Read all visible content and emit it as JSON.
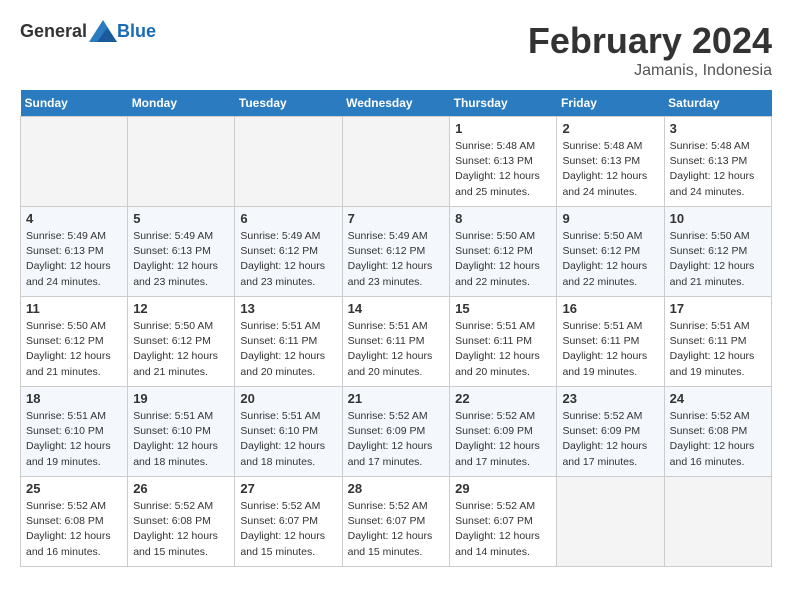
{
  "header": {
    "logo_general": "General",
    "logo_blue": "Blue",
    "month_title": "February 2024",
    "subtitle": "Jamanis, Indonesia"
  },
  "days_of_week": [
    "Sunday",
    "Monday",
    "Tuesday",
    "Wednesday",
    "Thursday",
    "Friday",
    "Saturday"
  ],
  "weeks": [
    [
      {
        "day": "",
        "info": ""
      },
      {
        "day": "",
        "info": ""
      },
      {
        "day": "",
        "info": ""
      },
      {
        "day": "",
        "info": ""
      },
      {
        "day": "1",
        "info": "Sunrise: 5:48 AM\nSunset: 6:13 PM\nDaylight: 12 hours\nand 25 minutes."
      },
      {
        "day": "2",
        "info": "Sunrise: 5:48 AM\nSunset: 6:13 PM\nDaylight: 12 hours\nand 24 minutes."
      },
      {
        "day": "3",
        "info": "Sunrise: 5:48 AM\nSunset: 6:13 PM\nDaylight: 12 hours\nand 24 minutes."
      }
    ],
    [
      {
        "day": "4",
        "info": "Sunrise: 5:49 AM\nSunset: 6:13 PM\nDaylight: 12 hours\nand 24 minutes."
      },
      {
        "day": "5",
        "info": "Sunrise: 5:49 AM\nSunset: 6:13 PM\nDaylight: 12 hours\nand 23 minutes."
      },
      {
        "day": "6",
        "info": "Sunrise: 5:49 AM\nSunset: 6:12 PM\nDaylight: 12 hours\nand 23 minutes."
      },
      {
        "day": "7",
        "info": "Sunrise: 5:49 AM\nSunset: 6:12 PM\nDaylight: 12 hours\nand 23 minutes."
      },
      {
        "day": "8",
        "info": "Sunrise: 5:50 AM\nSunset: 6:12 PM\nDaylight: 12 hours\nand 22 minutes."
      },
      {
        "day": "9",
        "info": "Sunrise: 5:50 AM\nSunset: 6:12 PM\nDaylight: 12 hours\nand 22 minutes."
      },
      {
        "day": "10",
        "info": "Sunrise: 5:50 AM\nSunset: 6:12 PM\nDaylight: 12 hours\nand 21 minutes."
      }
    ],
    [
      {
        "day": "11",
        "info": "Sunrise: 5:50 AM\nSunset: 6:12 PM\nDaylight: 12 hours\nand 21 minutes."
      },
      {
        "day": "12",
        "info": "Sunrise: 5:50 AM\nSunset: 6:12 PM\nDaylight: 12 hours\nand 21 minutes."
      },
      {
        "day": "13",
        "info": "Sunrise: 5:51 AM\nSunset: 6:11 PM\nDaylight: 12 hours\nand 20 minutes."
      },
      {
        "day": "14",
        "info": "Sunrise: 5:51 AM\nSunset: 6:11 PM\nDaylight: 12 hours\nand 20 minutes."
      },
      {
        "day": "15",
        "info": "Sunrise: 5:51 AM\nSunset: 6:11 PM\nDaylight: 12 hours\nand 20 minutes."
      },
      {
        "day": "16",
        "info": "Sunrise: 5:51 AM\nSunset: 6:11 PM\nDaylight: 12 hours\nand 19 minutes."
      },
      {
        "day": "17",
        "info": "Sunrise: 5:51 AM\nSunset: 6:11 PM\nDaylight: 12 hours\nand 19 minutes."
      }
    ],
    [
      {
        "day": "18",
        "info": "Sunrise: 5:51 AM\nSunset: 6:10 PM\nDaylight: 12 hours\nand 19 minutes."
      },
      {
        "day": "19",
        "info": "Sunrise: 5:51 AM\nSunset: 6:10 PM\nDaylight: 12 hours\nand 18 minutes."
      },
      {
        "day": "20",
        "info": "Sunrise: 5:51 AM\nSunset: 6:10 PM\nDaylight: 12 hours\nand 18 minutes."
      },
      {
        "day": "21",
        "info": "Sunrise: 5:52 AM\nSunset: 6:09 PM\nDaylight: 12 hours\nand 17 minutes."
      },
      {
        "day": "22",
        "info": "Sunrise: 5:52 AM\nSunset: 6:09 PM\nDaylight: 12 hours\nand 17 minutes."
      },
      {
        "day": "23",
        "info": "Sunrise: 5:52 AM\nSunset: 6:09 PM\nDaylight: 12 hours\nand 17 minutes."
      },
      {
        "day": "24",
        "info": "Sunrise: 5:52 AM\nSunset: 6:08 PM\nDaylight: 12 hours\nand 16 minutes."
      }
    ],
    [
      {
        "day": "25",
        "info": "Sunrise: 5:52 AM\nSunset: 6:08 PM\nDaylight: 12 hours\nand 16 minutes."
      },
      {
        "day": "26",
        "info": "Sunrise: 5:52 AM\nSunset: 6:08 PM\nDaylight: 12 hours\nand 15 minutes."
      },
      {
        "day": "27",
        "info": "Sunrise: 5:52 AM\nSunset: 6:07 PM\nDaylight: 12 hours\nand 15 minutes."
      },
      {
        "day": "28",
        "info": "Sunrise: 5:52 AM\nSunset: 6:07 PM\nDaylight: 12 hours\nand 15 minutes."
      },
      {
        "day": "29",
        "info": "Sunrise: 5:52 AM\nSunset: 6:07 PM\nDaylight: 12 hours\nand 14 minutes."
      },
      {
        "day": "",
        "info": ""
      },
      {
        "day": "",
        "info": ""
      }
    ]
  ]
}
